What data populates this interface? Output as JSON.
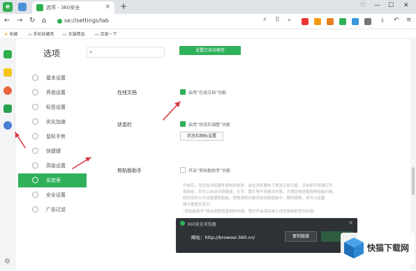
{
  "tabbar": {
    "tab_title": "选项 - 360安全",
    "tab_close": "×",
    "new_tab": "+",
    "logo_letter": "e"
  },
  "window_controls": {
    "minimize": "—",
    "maximize": "☐",
    "close": "✕"
  },
  "toolbar": {
    "back": "←",
    "forward": "→",
    "refresh": "↻",
    "home": "⌂",
    "url": "se://settings/lab"
  },
  "bookmarks": [
    {
      "label": "收藏"
    },
    {
      "label": "手机收藏夹"
    },
    {
      "label": "天猫精选"
    },
    {
      "label": "百度一下"
    }
  ],
  "settings_nav": {
    "title": "选项",
    "items": [
      {
        "label": "基本设置"
      },
      {
        "label": "界面设置"
      },
      {
        "label": "标签设置"
      },
      {
        "label": "优化加速"
      },
      {
        "label": "鼠标手势"
      },
      {
        "label": "快捷键"
      },
      {
        "label": "高级设置"
      },
      {
        "label": "实验室"
      },
      {
        "label": "安全设置"
      },
      {
        "label": "广告过滤"
      }
    ]
  },
  "search": {
    "placeholder": ""
  },
  "toast": "设置已自动保存",
  "sections": {
    "online_docs": {
      "label": "在线文档",
      "option": "启用“在线文档”功能"
    },
    "status_bar": {
      "label": "状态栏",
      "option": "启用“状态栏调整”功能",
      "button": "状态栏图标设置"
    },
    "clipboard": {
      "label": "剪贴板助手",
      "option": "开启“剪贴板助手”功能"
    }
  },
  "description_lines": [
    "开启后，当您在浏览器外复制网址时，会在浏览器右下角显示提示框，点击即可快速打开",
    "该网址，并可以自动识别链接、文字、图片等不同格式内容，方便您快速使用剪贴板内容。",
    "同时也可以手动管理剪贴板，把常用的内容添加到剪贴板中，随时调用，也可以设置",
    "提示框是否显示。",
    "“剪贴板助手”将会读取您复制的内容，我们不会保存或上传您复制的任何内容。"
  ],
  "preview": {
    "title": "360安全浏览器",
    "url_text": "网址：http://browser.360.cn/",
    "copy_button": "复制链接",
    "close": "×"
  },
  "watermark": {
    "text": "快猫下载网"
  },
  "colors": {
    "accent_green": "#2fb05a",
    "arrow_red": "#d9363e",
    "preview_bg": "#2e3236"
  }
}
